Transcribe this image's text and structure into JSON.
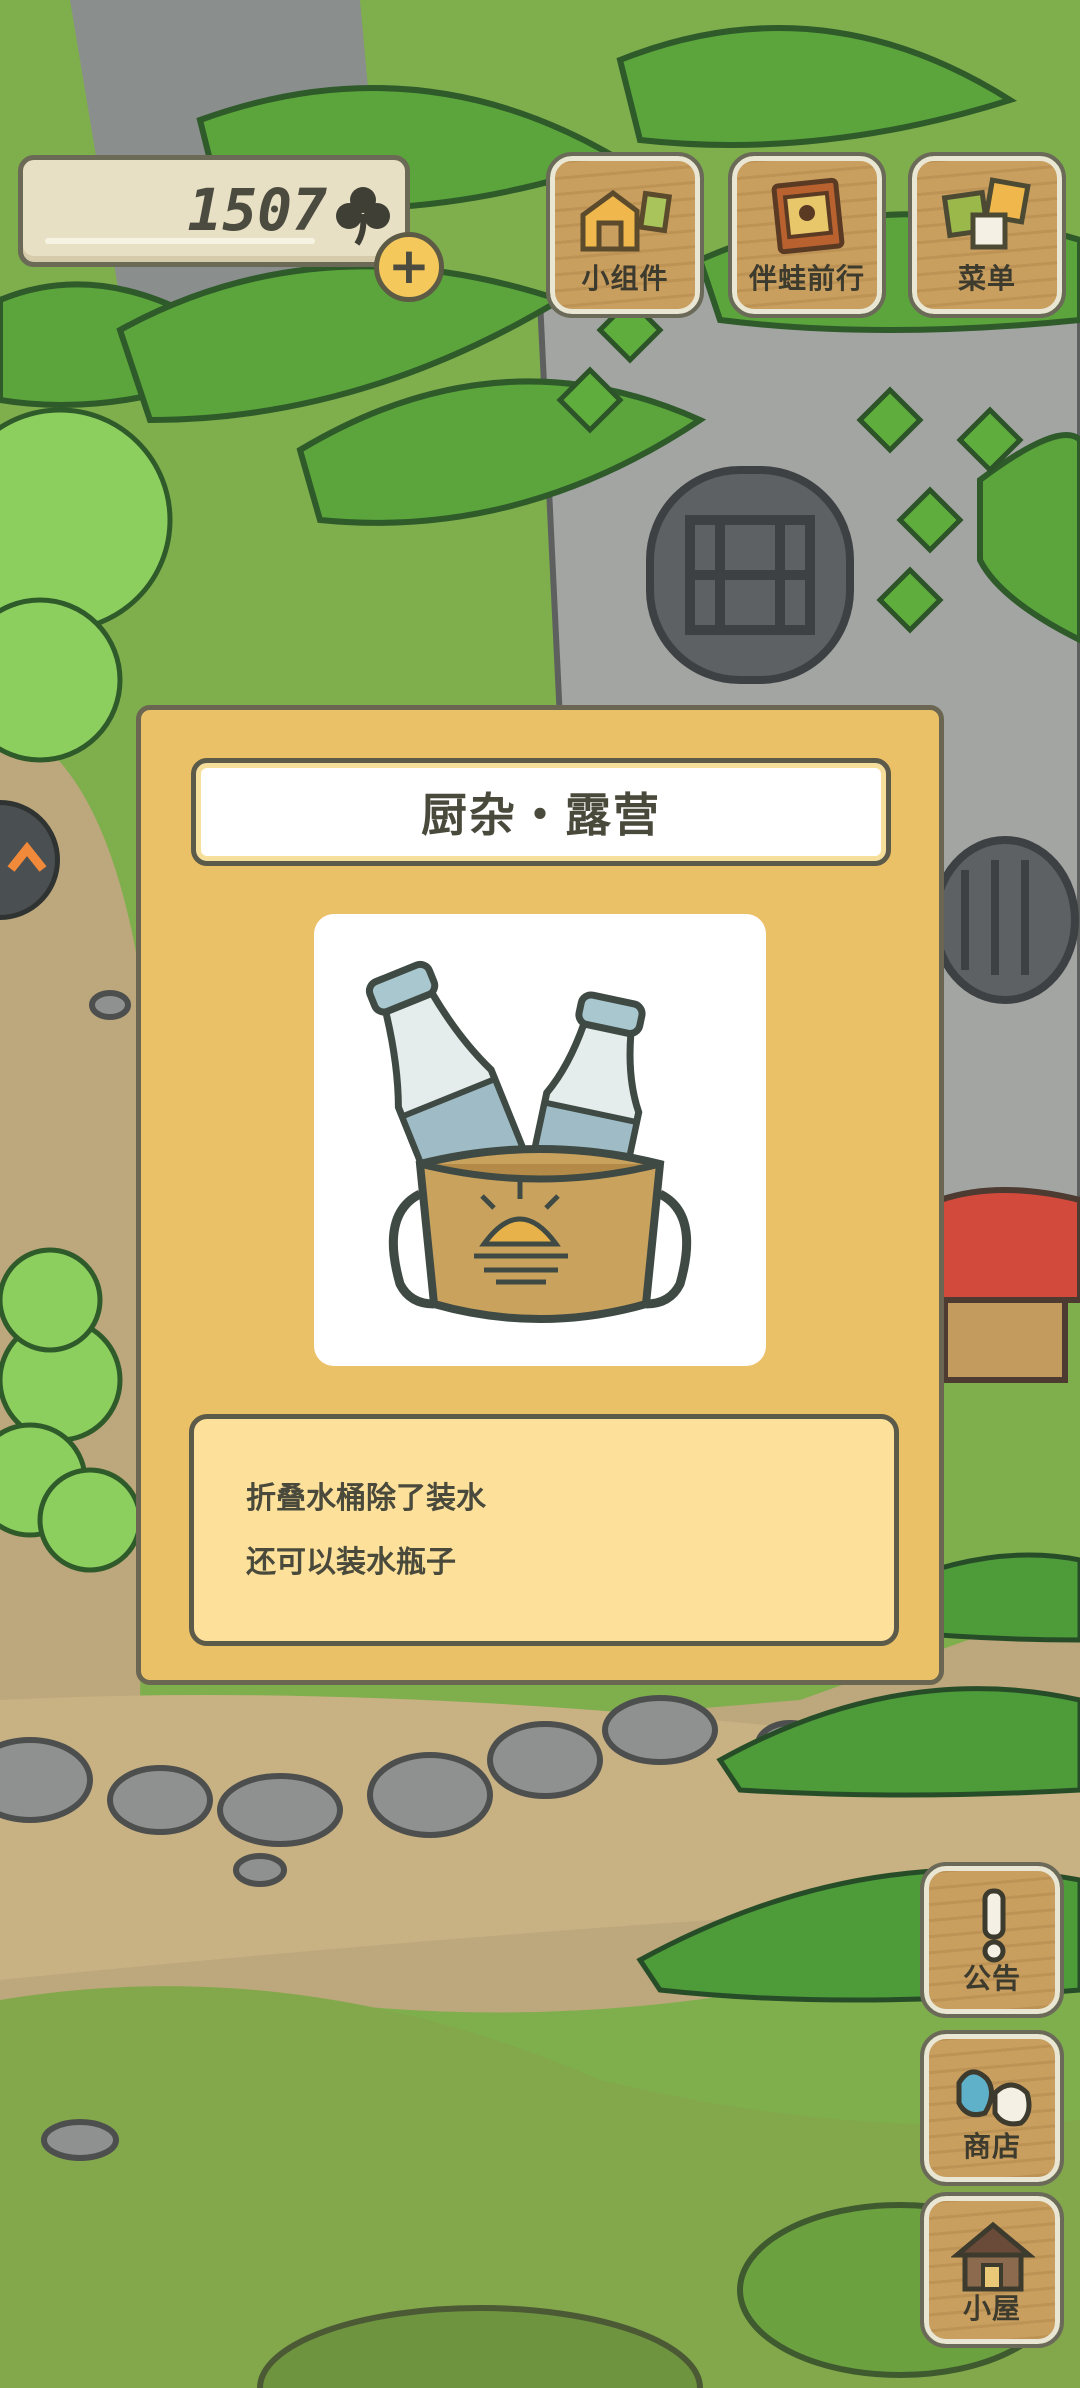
{
  "hud": {
    "clover_count": "1507",
    "clover_icon": "clover-icon",
    "add_icon": "+"
  },
  "top_buttons": {
    "widgets": {
      "label": "小组件",
      "icon": "widget-blocks-icon"
    },
    "travel": {
      "label": "伴蛙前行",
      "icon": "travel-book-icon"
    },
    "menu": {
      "label": "菜单",
      "icon": "menu-squares-icon"
    }
  },
  "side_buttons": {
    "notice": {
      "label": "公告",
      "icon": "exclamation-icon"
    },
    "shop": {
      "label": "商店",
      "icon": "shop-bags-icon"
    },
    "house": {
      "label": "小屋",
      "icon": "house-icon"
    }
  },
  "item_popup": {
    "title": "厨杂・露营",
    "image": "bottles-in-folding-bucket",
    "description": [
      "折叠水桶除了装水",
      "还可以装水瓶子"
    ]
  },
  "colors": {
    "card_bg": "#ebc168",
    "desc_bg": "#fde19a",
    "outline": "#5c5a48",
    "leaf_green": "#5da83f",
    "rock_grey": "#9a9c9a"
  }
}
